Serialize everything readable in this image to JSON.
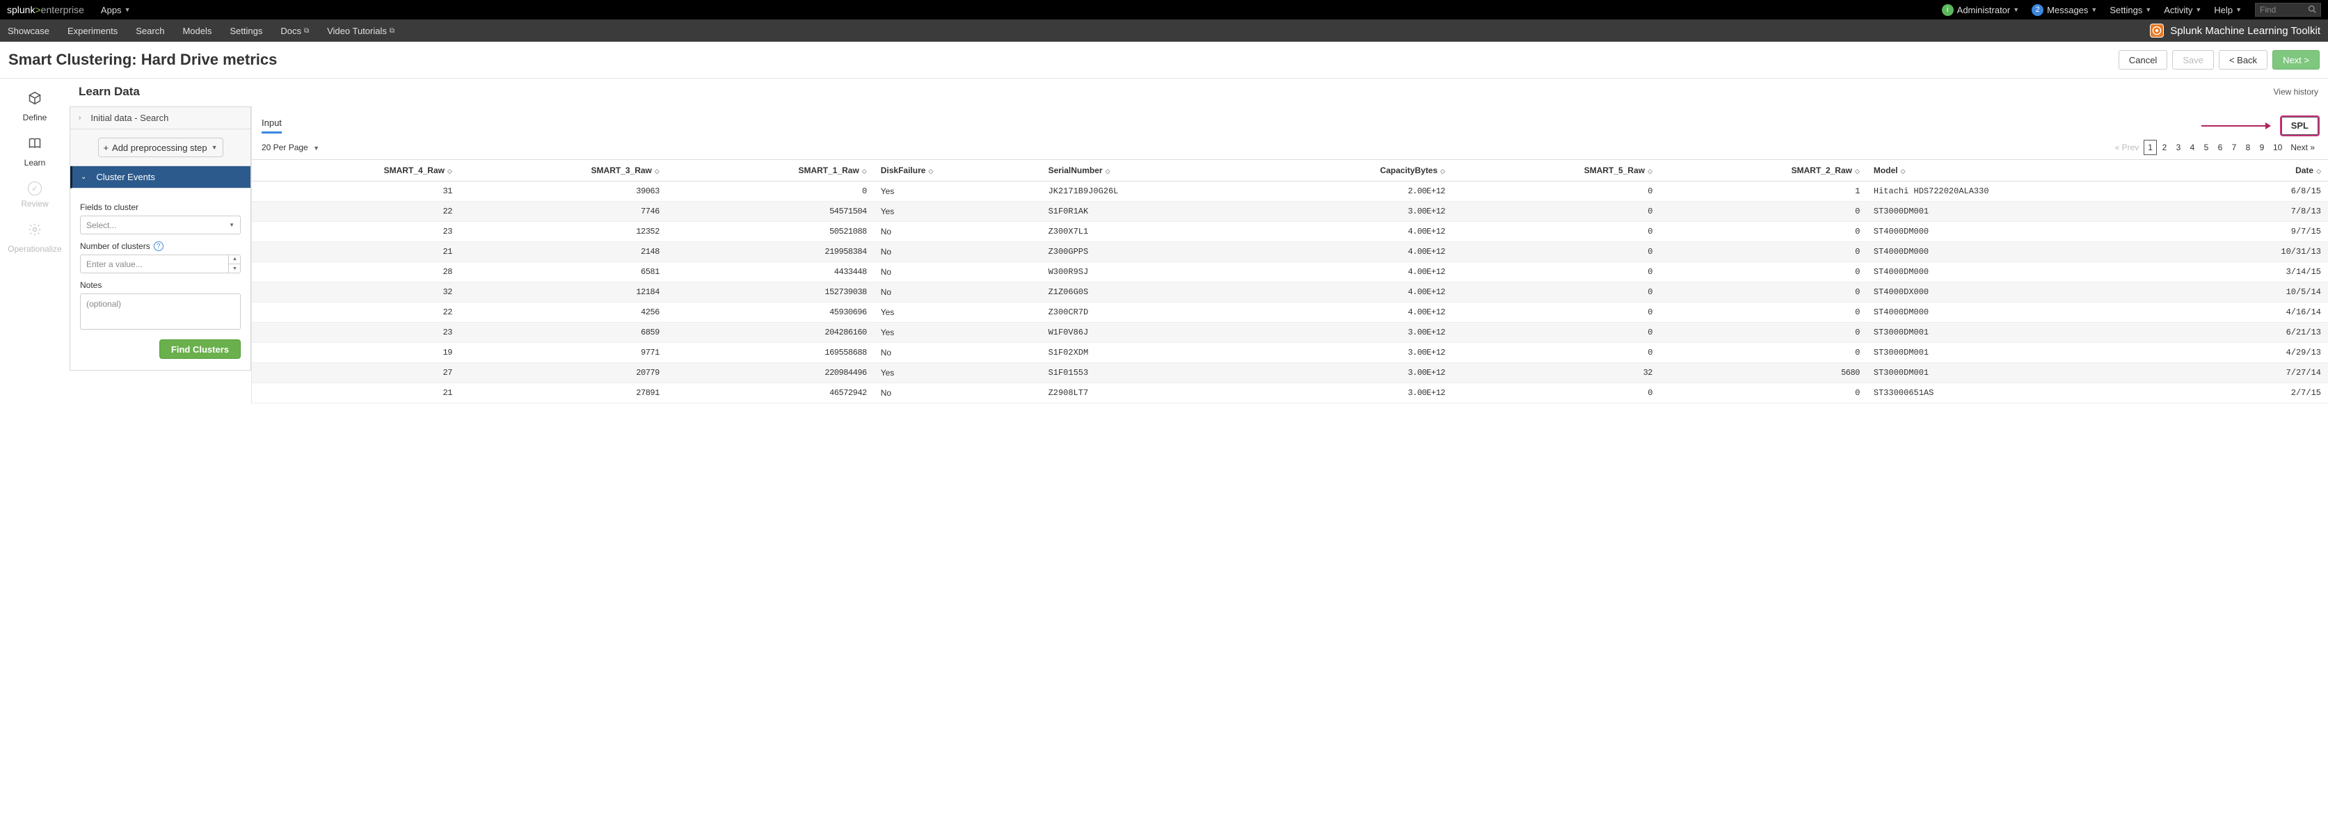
{
  "topbar": {
    "brand_splunk": "splunk",
    "brand_gt": ">",
    "brand_enterprise": "enterprise",
    "apps": "Apps",
    "admin_badge": "i",
    "admin": "Administrator",
    "msg_badge": "2",
    "messages": "Messages",
    "settings": "Settings",
    "activity": "Activity",
    "help": "Help",
    "find_placeholder": "Find"
  },
  "subbar": {
    "items": [
      "Showcase",
      "Experiments",
      "Search",
      "Models",
      "Settings",
      "Docs",
      "Video Tutorials"
    ],
    "external_index": [
      5,
      6
    ],
    "product": "Splunk Machine Learning Toolkit"
  },
  "page": {
    "title": "Smart Clustering: Hard Drive metrics",
    "cancel": "Cancel",
    "save": "Save",
    "back": "< Back",
    "next": "Next >"
  },
  "rail": {
    "steps": [
      {
        "label": "Define",
        "active": true
      },
      {
        "label": "Learn",
        "active": true
      },
      {
        "label": "Review",
        "active": false
      },
      {
        "label": "Operationalize",
        "active": false
      }
    ]
  },
  "learn": {
    "heading": "Learn Data",
    "view_history": "View history",
    "initial_data": "Initial data - Search",
    "add_preprocess": "Add preprocessing step",
    "cluster_events": "Cluster Events",
    "fields_to_cluster": "Fields to cluster",
    "select_placeholder": "Select...",
    "num_clusters": "Number of clusters",
    "num_placeholder": "Enter a value...",
    "notes": "Notes",
    "notes_placeholder": "(optional)",
    "find_clusters": "Find Clusters"
  },
  "results": {
    "input_tab": "Input",
    "spl": "SPL",
    "per_page": "20 Per Page",
    "pager_prev": "« Prev",
    "pager_next": "Next »",
    "pages": [
      "1",
      "2",
      "3",
      "4",
      "5",
      "6",
      "7",
      "8",
      "9",
      "10"
    ],
    "columns": [
      "SMART_4_Raw",
      "SMART_3_Raw",
      "SMART_1_Raw",
      "DiskFailure",
      "SerialNumber",
      "CapacityBytes",
      "SMART_5_Raw",
      "SMART_2_Raw",
      "Model",
      "Date"
    ],
    "col_align": [
      "r",
      "r",
      "r",
      "l",
      "l",
      "r",
      "r",
      "r",
      "l",
      "r"
    ],
    "rows": [
      [
        "31",
        "39063",
        "0",
        "Yes",
        "JK2171B9J0G26L",
        "2.00E+12",
        "0",
        "1",
        "Hitachi HDS722020ALA330",
        "6/8/15"
      ],
      [
        "22",
        "7746",
        "54571504",
        "Yes",
        "S1F0R1AK",
        "3.00E+12",
        "0",
        "0",
        "ST3000DM001",
        "7/8/13"
      ],
      [
        "23",
        "12352",
        "50521088",
        "No",
        "Z300X7L1",
        "4.00E+12",
        "0",
        "0",
        "ST4000DM000",
        "9/7/15"
      ],
      [
        "21",
        "2148",
        "219958384",
        "No",
        "Z300GPPS",
        "4.00E+12",
        "0",
        "0",
        "ST4000DM000",
        "10/31/13"
      ],
      [
        "28",
        "6581",
        "4433448",
        "No",
        "W300R9SJ",
        "4.00E+12",
        "0",
        "0",
        "ST4000DM000",
        "3/14/15"
      ],
      [
        "32",
        "12184",
        "152739038",
        "No",
        "Z1Z06G0S",
        "4.00E+12",
        "0",
        "0",
        "ST4000DX000",
        "10/5/14"
      ],
      [
        "22",
        "4256",
        "45930696",
        "Yes",
        "Z300CR7D",
        "4.00E+12",
        "0",
        "0",
        "ST4000DM000",
        "4/16/14"
      ],
      [
        "23",
        "6859",
        "204286160",
        "Yes",
        "W1F0V86J",
        "3.00E+12",
        "0",
        "0",
        "ST3000DM001",
        "6/21/13"
      ],
      [
        "19",
        "9771",
        "169558688",
        "No",
        "S1F02XDM",
        "3.00E+12",
        "0",
        "0",
        "ST3000DM001",
        "4/29/13"
      ],
      [
        "27",
        "20779",
        "220984496",
        "Yes",
        "S1F01553",
        "3.00E+12",
        "32",
        "5680",
        "ST3000DM001",
        "7/27/14"
      ],
      [
        "21",
        "27891",
        "46572942",
        "No",
        "Z2908LT7",
        "3.00E+12",
        "0",
        "0",
        "ST33000651AS",
        "2/7/15"
      ]
    ]
  }
}
